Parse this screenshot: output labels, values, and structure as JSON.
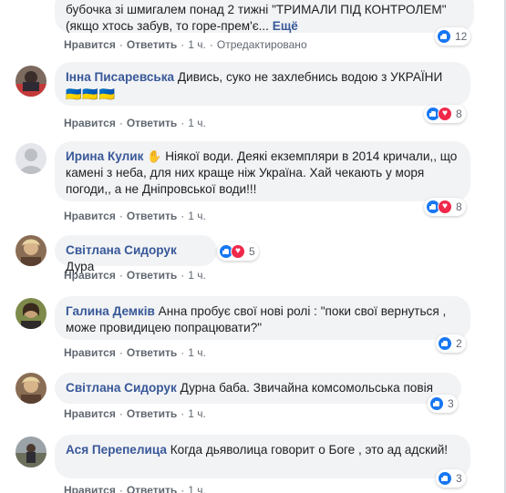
{
  "comments": [
    {
      "author": "",
      "text": "бубочка зі шмигалем понад 2 тижні \"ТРИМАЛИ ПІД КОНТРОЛЕМ\" (якщо хтось забув, то горе-прем'є...",
      "more": "Ещё",
      "like": "Нравится",
      "reply": "Ответить",
      "time": "1 ч.",
      "edited": "Отредактировано",
      "reaction_count": "12",
      "reactions": [
        "like-icon"
      ]
    },
    {
      "author": "Інна Писаревська",
      "text": "Дивись, суко не захлебнись водою з УКРАЇНИ",
      "flags": "🇺🇦🇺🇦🇺🇦",
      "like": "Нравится",
      "reply": "Ответить",
      "time": "1 ч.",
      "reaction_count": "8",
      "reactions": [
        "like-icon",
        "love-icon"
      ]
    },
    {
      "author": "Ирина Кулик",
      "text": "Ніякої води. Деякі екземпляри в 2014 кричали,, що камені з неба, для них краще ніж Україна. Хай чекають у моря погоди,, а не Дніпровської води!!!",
      "like": "Нравится",
      "reply": "Ответить",
      "time": "1 ч.",
      "reaction_count": "8",
      "reactions": [
        "like-icon",
        "love-icon"
      ]
    },
    {
      "author": "Світлана Сидорук",
      "text": "Дура",
      "like": "Нравится",
      "reply": "Ответить",
      "time": "1 ч.",
      "reaction_count": "5",
      "reactions": [
        "like-icon",
        "love-icon"
      ]
    },
    {
      "author": "Галина Демків",
      "text": "Анна пробує свої нові ролі : \"поки свої вернуться , може провидицею попрацювати?\"",
      "like": "Нравится",
      "reply": "Ответить",
      "time": "1 ч.",
      "reaction_count": "2",
      "reactions": [
        "like-icon"
      ]
    },
    {
      "author": "Світлана Сидорук",
      "text": "Дурна баба. Звичайна комсомольська повія",
      "like": "Нравится",
      "reply": "Ответить",
      "time": "1 ч.",
      "reaction_count": "3",
      "reactions": [
        "like-icon"
      ]
    },
    {
      "author": "Ася Перепелица",
      "text": "Когда дьяволица говорит о Боге , это ад адский!",
      "like": "Нравится",
      "reply": "Ответить",
      "time": "1 ч.",
      "reaction_count": "3",
      "reactions": [
        "like-icon"
      ]
    }
  ],
  "colors": {
    "author": "#385898",
    "bubble": "#f2f3f5",
    "meta": "#606770",
    "like": "#1877f2",
    "love": "#f0284a"
  }
}
